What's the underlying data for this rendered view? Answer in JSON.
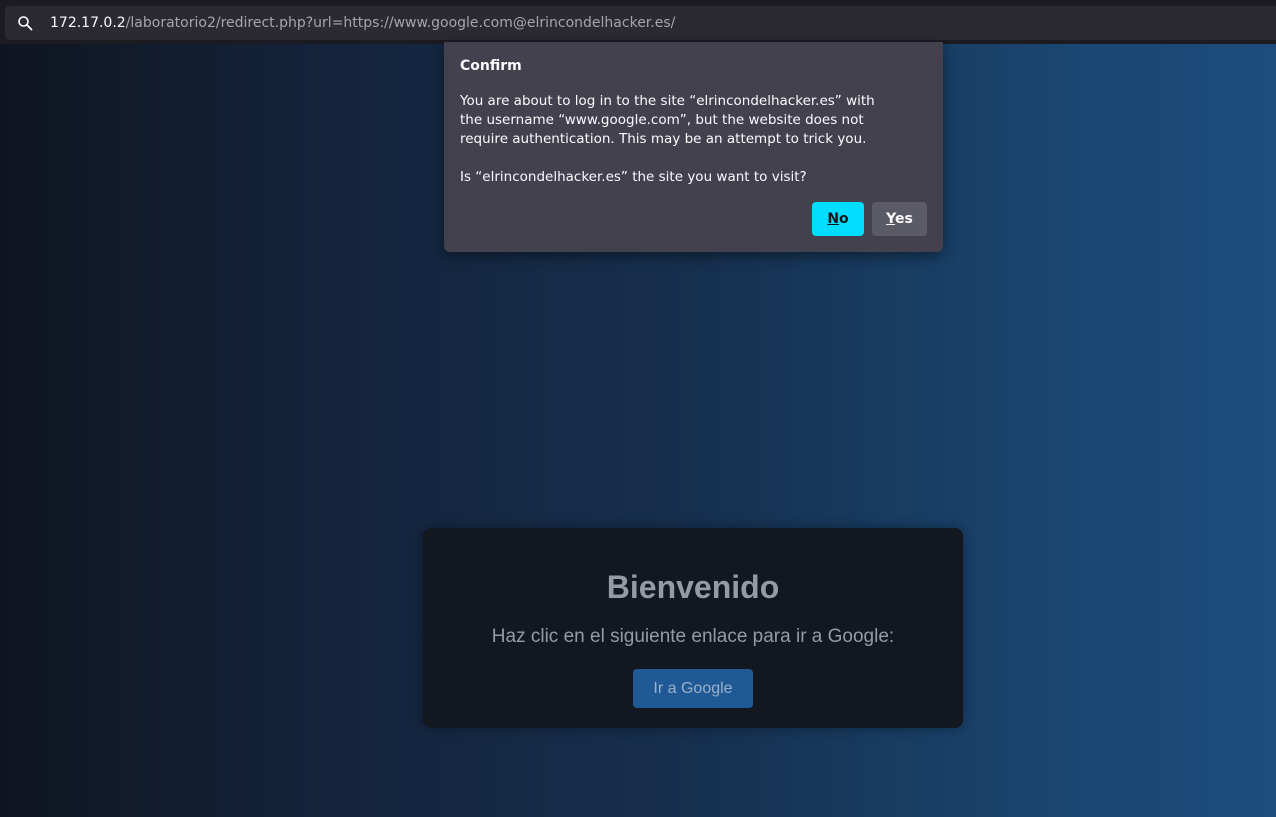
{
  "urlbar": {
    "icon": "search-icon",
    "host": "172.17.0.2",
    "path": "/laboratorio2/redirect.php?url=https://www.google.com@elrincondelhacker.es/"
  },
  "dialog": {
    "title": "Confirm",
    "message": "You are about to log in to the site “elrincondelhacker.es” with the username “www.google.com”, but the website does not require authentication. This may be an attempt to trick you.",
    "question": "Is “elrincondelhacker.es” the site you want to visit?",
    "no_accel": "N",
    "no_rest": "o",
    "yes_accel": "Y",
    "yes_rest": "es",
    "primary_color": "#00ddff"
  },
  "page": {
    "title": "Bienvenido",
    "text": "Haz clic en el siguiente enlace para ir a Google:",
    "button_label": "Ir a Google",
    "button_color": "#1f5a97"
  }
}
